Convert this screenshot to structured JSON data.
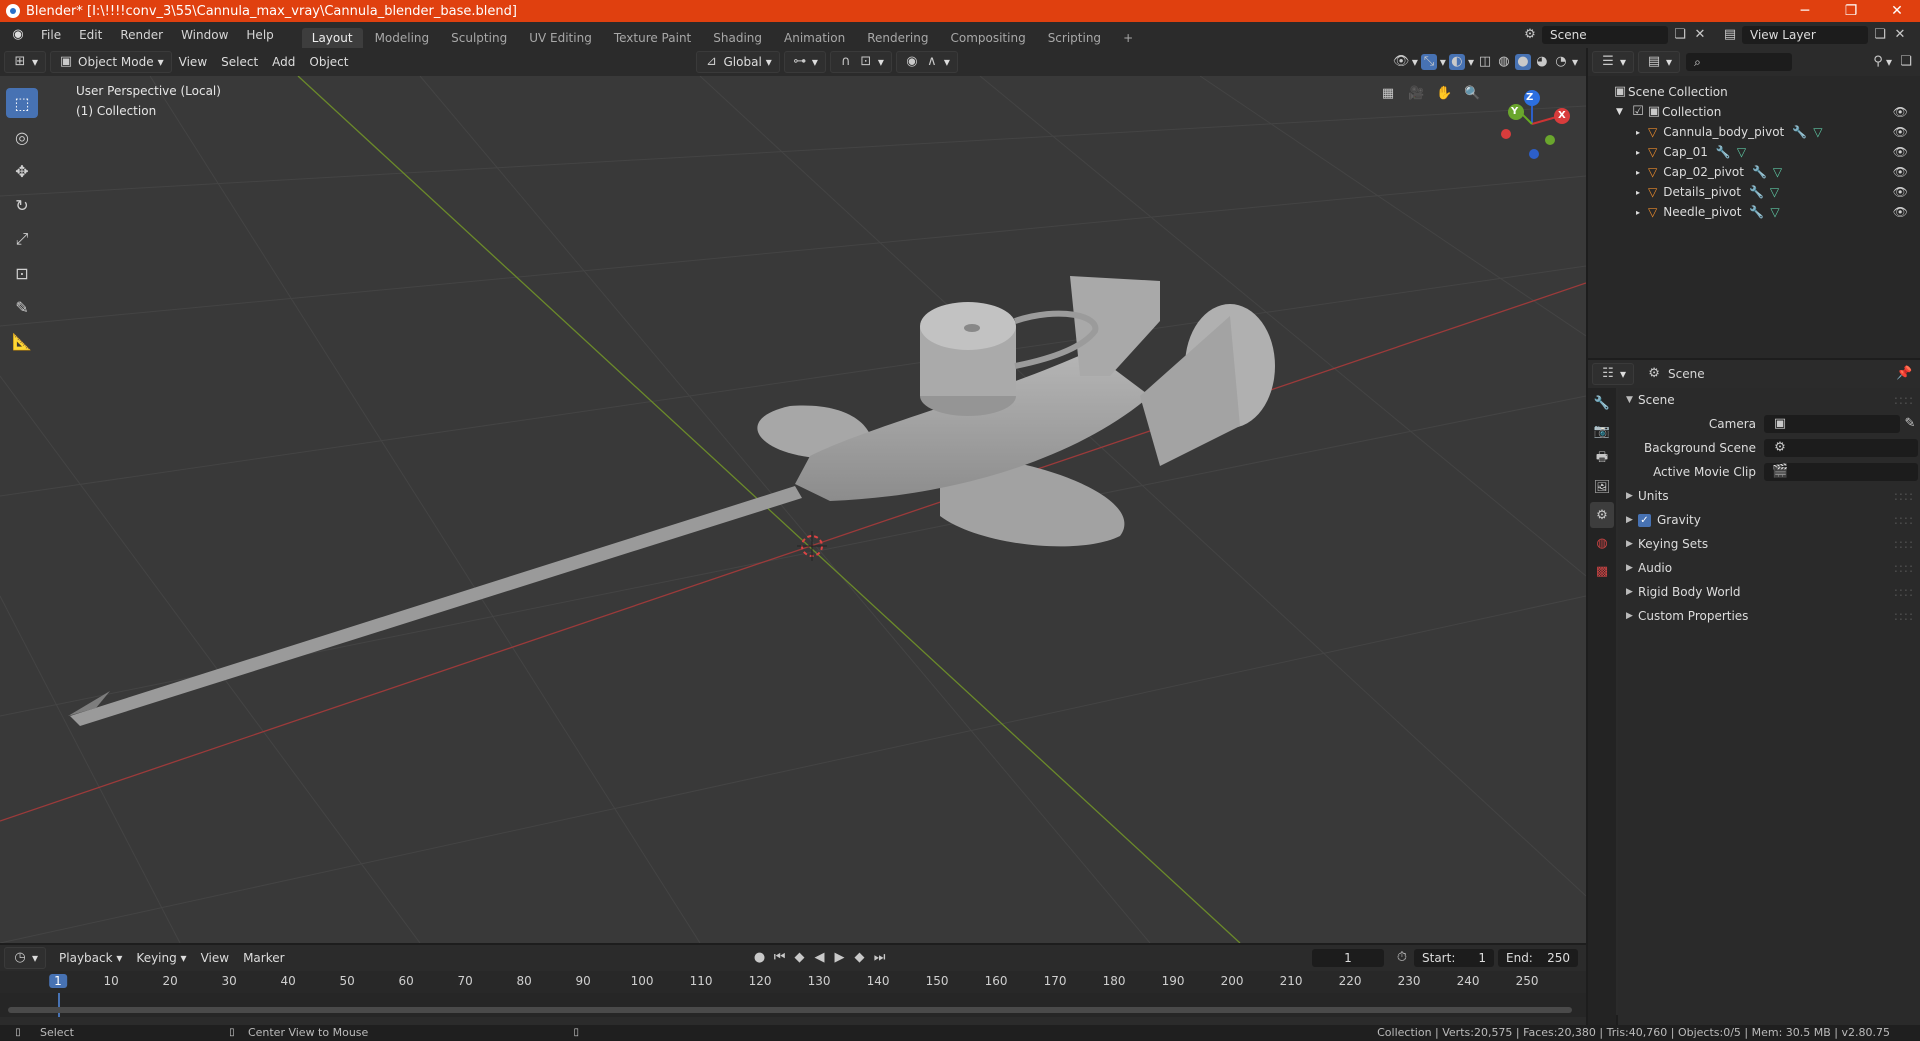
{
  "title_bar": {
    "title": "Blender* [I:\\!!!!conv_3\\55\\Cannula_max_vray\\Cannula_blender_base.blend]",
    "minimize": "─",
    "maximize": "❐",
    "close": "✕"
  },
  "menu": [
    "File",
    "Edit",
    "Render",
    "Window",
    "Help"
  ],
  "workspace_tabs": [
    "Layout",
    "Modeling",
    "Sculpting",
    "UV Editing",
    "Texture Paint",
    "Shading",
    "Animation",
    "Rendering",
    "Compositing",
    "Scripting"
  ],
  "active_workspace": "Layout",
  "scene_field": "Scene",
  "view_layer_field": "View Layer",
  "viewport_header": {
    "mode": "Object Mode",
    "menus": [
      "View",
      "Select",
      "Add",
      "Object"
    ],
    "orientation": "Global"
  },
  "viewport": {
    "perspective_label": "User Perspective (Local)",
    "collection_label": "(1) Collection",
    "axes": {
      "x": "X",
      "y": "Y",
      "z": "Z"
    }
  },
  "outliner": {
    "search_placeholder": "",
    "root": "Scene Collection",
    "collection": "Collection",
    "objects": [
      "Cannula_body_pivot",
      "Cap_01",
      "Cap_02_pivot",
      "Details_pivot",
      "Needle_pivot"
    ]
  },
  "properties": {
    "context": "Scene",
    "panel_title": "Scene",
    "fields": [
      {
        "label": "Camera",
        "value": ""
      },
      {
        "label": "Background Scene",
        "value": ""
      },
      {
        "label": "Active Movie Clip",
        "value": ""
      }
    ],
    "panels": [
      "Units",
      "Gravity",
      "Keying Sets",
      "Audio",
      "Rigid Body World",
      "Custom Properties"
    ],
    "gravity_checked": true
  },
  "timeline": {
    "menus": [
      "Playback",
      "Keying",
      "View",
      "Marker"
    ],
    "current_frame": "1",
    "start_label": "Start:",
    "start": "1",
    "end_label": "End:",
    "end": "250",
    "ticks": [
      "1",
      "10",
      "20",
      "30",
      "40",
      "50",
      "60",
      "70",
      "80",
      "90",
      "100",
      "110",
      "120",
      "130",
      "140",
      "150",
      "160",
      "170",
      "180",
      "190",
      "200",
      "210",
      "220",
      "230",
      "240",
      "250"
    ]
  },
  "status_bar": {
    "left": "Select",
    "middle": "Center View to Mouse",
    "stats": "Collection | Verts:20,575 | Faces:20,380 | Tris:40,760 | Objects:0/5 | Mem: 30.5 MB | v2.80.75"
  }
}
